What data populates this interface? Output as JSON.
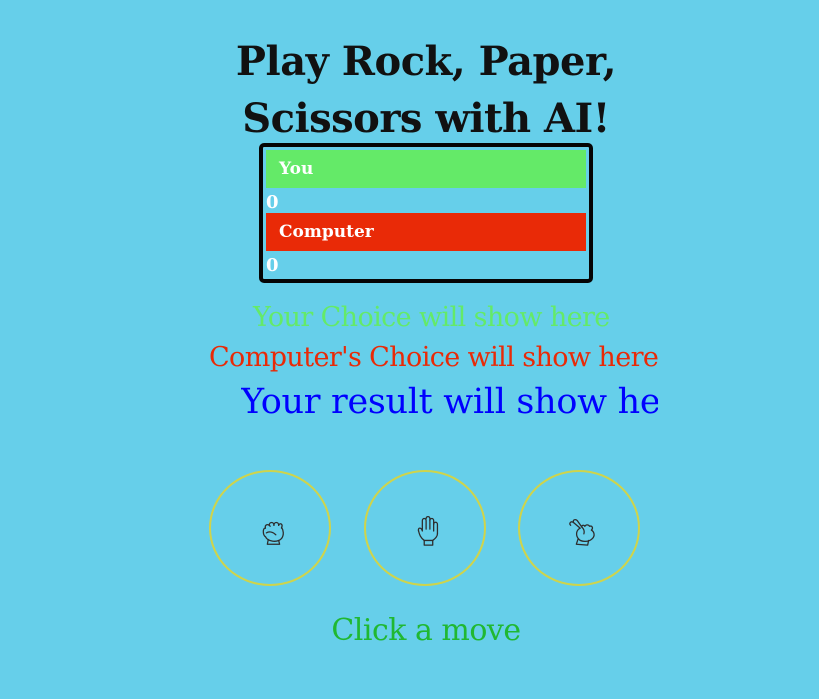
{
  "page": {
    "title_line_1": "Play Rock, Paper,",
    "title_line_2": "Scissors with AI!"
  },
  "scoreboard": {
    "player": {
      "label": "You",
      "score": "0"
    },
    "computer": {
      "label": "Computer",
      "score": "0"
    }
  },
  "choices": {
    "player": "Your Choice will show here",
    "computer": "Computer's Choice will show here",
    "result": "Your result will show here"
  },
  "moves": [
    {
      "name": "rock",
      "icon": "fist-icon"
    },
    {
      "name": "paper",
      "icon": "open-hand-icon"
    },
    {
      "name": "scissors",
      "icon": "scissors-hand-icon"
    }
  ],
  "prompt": "Click a move",
  "colors": {
    "background": "#66cfea",
    "player": "#64ea68",
    "computer": "#e92a07",
    "result": "#0000ff",
    "prompt": "#20b832",
    "move_border": "#cfd44b"
  }
}
